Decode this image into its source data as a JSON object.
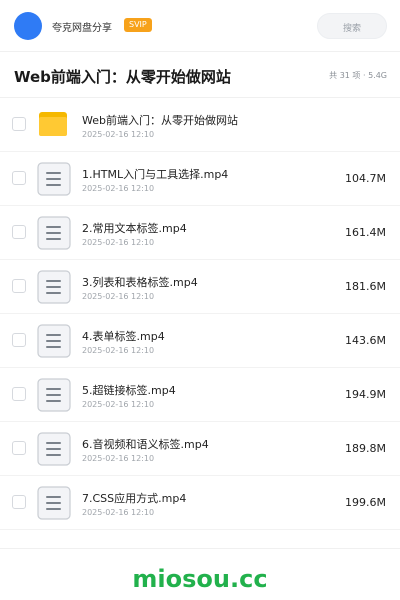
{
  "topbar": {
    "share_name": "夸克网盘分享",
    "badge": "SVIP",
    "search_placeholder": "搜索",
    "avatar_color": "#2f7bf5",
    "badge_color": "#f7a21b"
  },
  "header": {
    "title": "Web前端入门：从零开始做网站",
    "meta": "共 31 项 · 5.4G"
  },
  "files": [
    {
      "name": "Web前端入门：从零开始做网站",
      "date": "2025-02-16 12:10",
      "size": "",
      "icon": "folder-icon"
    },
    {
      "name": "1.HTML入门与工具选择.mp4",
      "date": "2025-02-16 12:10",
      "size": "104.7M",
      "icon": "file-icon"
    },
    {
      "name": "2.常用文本标签.mp4",
      "date": "2025-02-16 12:10",
      "size": "161.4M",
      "icon": "file-icon"
    },
    {
      "name": "3.列表和表格标签.mp4",
      "date": "2025-02-16 12:10",
      "size": "181.6M",
      "icon": "file-icon"
    },
    {
      "name": "4.表单标签.mp4",
      "date": "2025-02-16 12:10",
      "size": "143.6M",
      "icon": "file-icon"
    },
    {
      "name": "5.超链接标签.mp4",
      "date": "2025-02-16 12:10",
      "size": "194.9M",
      "icon": "file-icon"
    },
    {
      "name": "6.音视频和语义标签.mp4",
      "date": "2025-02-16 12:10",
      "size": "189.8M",
      "icon": "file-icon"
    },
    {
      "name": "7.CSS应用方式.mp4",
      "date": "2025-02-16 12:10",
      "size": "199.6M",
      "icon": "file-icon"
    }
  ],
  "footer": {
    "brand": "miosou.cc",
    "brand_color": "#22b14c"
  }
}
